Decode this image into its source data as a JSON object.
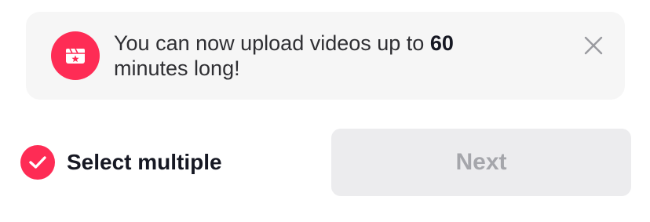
{
  "banner": {
    "text_prefix": "You can now upload videos up to ",
    "text_bold": "60",
    "text_suffix": " minutes long!",
    "icon": "video-upload-star-icon",
    "close_icon": "close-icon"
  },
  "select_multiple": {
    "label": "Select multiple",
    "checked": true,
    "icon": "checkmark-icon"
  },
  "next_button": {
    "label": "Next",
    "enabled": false
  },
  "colors": {
    "accent": "#fe2c55",
    "banner_bg": "#f6f6f6",
    "button_disabled_bg": "#ececee",
    "button_disabled_text": "#a5a6ab",
    "text_primary": "#161823"
  }
}
